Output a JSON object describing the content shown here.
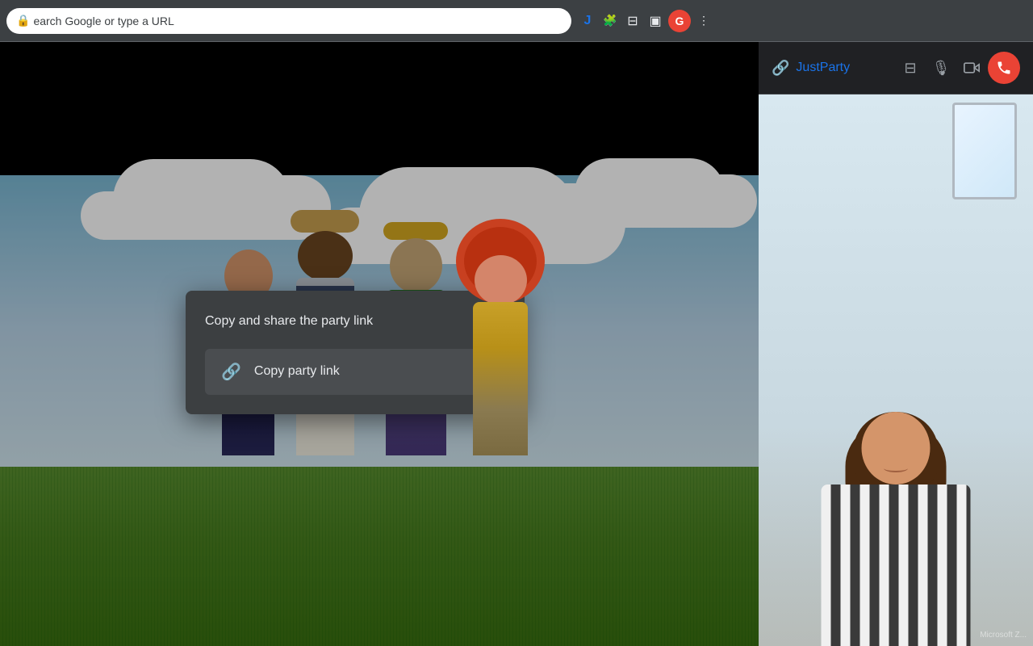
{
  "browser": {
    "address": "earch Google or type a URL",
    "lock_icon": "🔒"
  },
  "extensions": [
    {
      "id": "justparty-ext",
      "icon": "J",
      "color": "#1a73e8"
    },
    {
      "id": "puzzle-ext",
      "icon": "🧩"
    },
    {
      "id": "media-ext",
      "icon": "⊟"
    },
    {
      "id": "split-ext",
      "icon": "⬜"
    }
  ],
  "avatar": {
    "letter": "G",
    "bg": "#ea4335"
  },
  "modal": {
    "title": "Copy and share the party link",
    "close_label": "✕",
    "copy_button": "Copy party link"
  },
  "sidebar": {
    "title": "JustParty",
    "controls": {
      "layout_icon": "⊟",
      "mic_icon": "🎙",
      "video_icon": "📹",
      "end_call_icon": "📞"
    },
    "watermark": "Microsoft Z..."
  }
}
